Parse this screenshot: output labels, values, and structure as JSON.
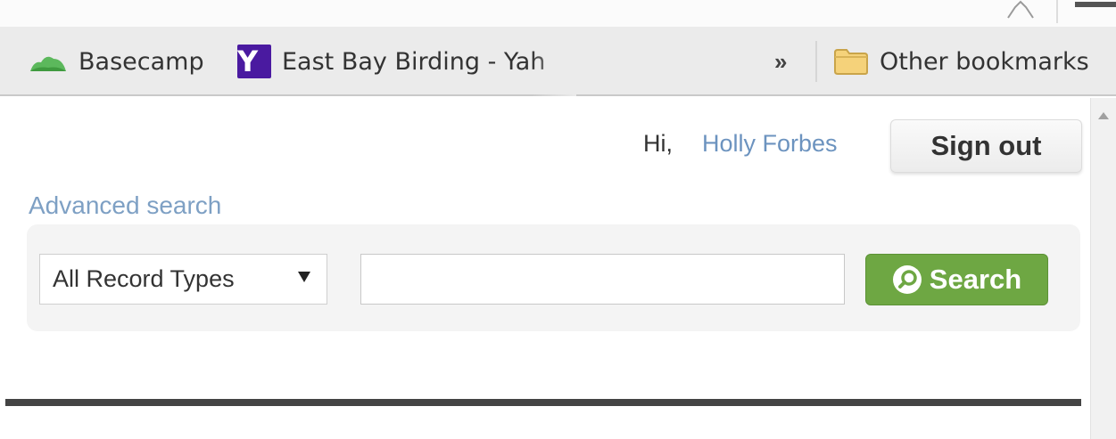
{
  "bookmarks": {
    "items": [
      {
        "label": "Basecamp",
        "icon": "basecamp-icon"
      },
      {
        "label": "East Bay Birding - Yah",
        "icon": "yahoo-icon"
      }
    ],
    "overflow_label": "»",
    "other_label": "Other bookmarks",
    "other_icon": "folder-icon"
  },
  "header": {
    "greeting": "Hi,",
    "user_name": "Holly Forbes",
    "sign_out_label": "Sign out"
  },
  "search": {
    "advanced_link": "Advanced search",
    "record_type_selected": "All Record Types",
    "query_value": "",
    "button_label": "Search"
  },
  "colors": {
    "link": "#6c93bf",
    "search_button": "#6ea743",
    "yahoo": "#4a1aa0"
  }
}
